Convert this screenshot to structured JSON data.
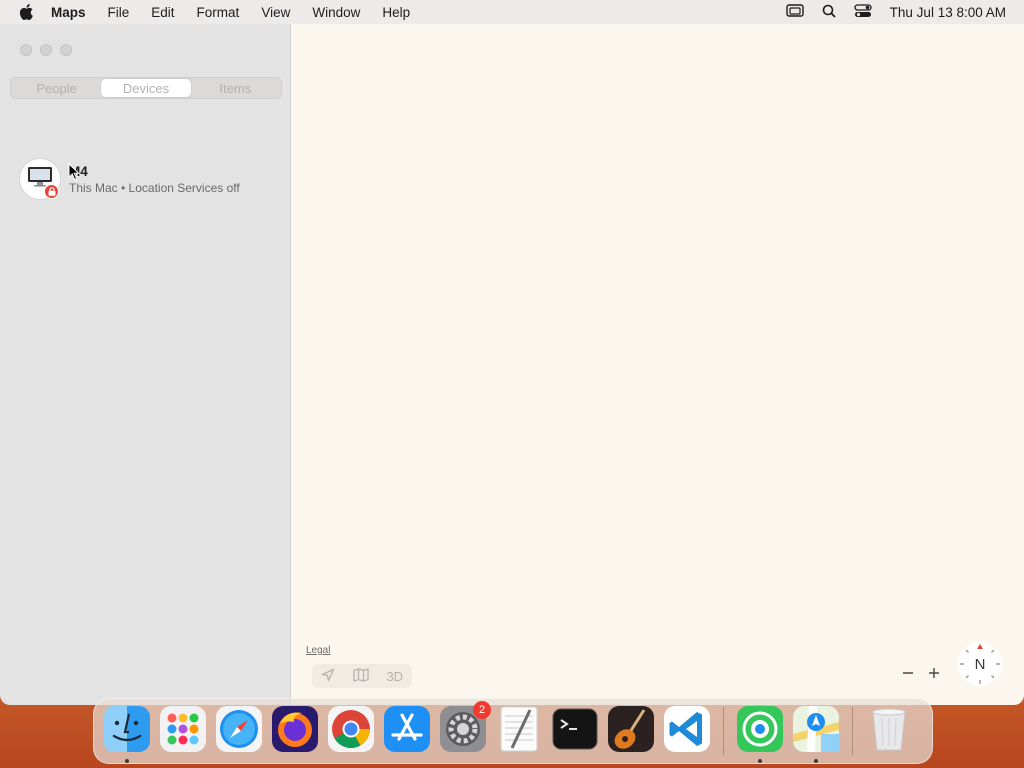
{
  "menubar": {
    "app_name": "Maps",
    "items": [
      "File",
      "Edit",
      "Format",
      "View",
      "Window",
      "Help"
    ],
    "clock": "Thu Jul 13  8:00 AM"
  },
  "sidebar": {
    "tabs": [
      {
        "label": "People",
        "active": false
      },
      {
        "label": "Devices",
        "active": true
      },
      {
        "label": "Items",
        "active": false
      }
    ],
    "devices": [
      {
        "name": "M4",
        "subtitle": "This Mac • Location Services off"
      }
    ]
  },
  "map": {
    "legal": "Legal",
    "mode_3d": "3D",
    "compass_label": "N"
  },
  "dock": {
    "settings_badge": "2",
    "apps": [
      "Finder",
      "Launchpad",
      "Safari",
      "Firefox",
      "Chrome",
      "App Store",
      "System Settings",
      "TextEdit",
      "Terminal",
      "GarageBand",
      "Visual Studio Code",
      "Find My",
      "Maps",
      "Trash"
    ]
  },
  "colors": {
    "accent_red": "#e5443a",
    "map_bg": "#fbf7ee",
    "sidebar_bg": "#e4e3e3"
  }
}
